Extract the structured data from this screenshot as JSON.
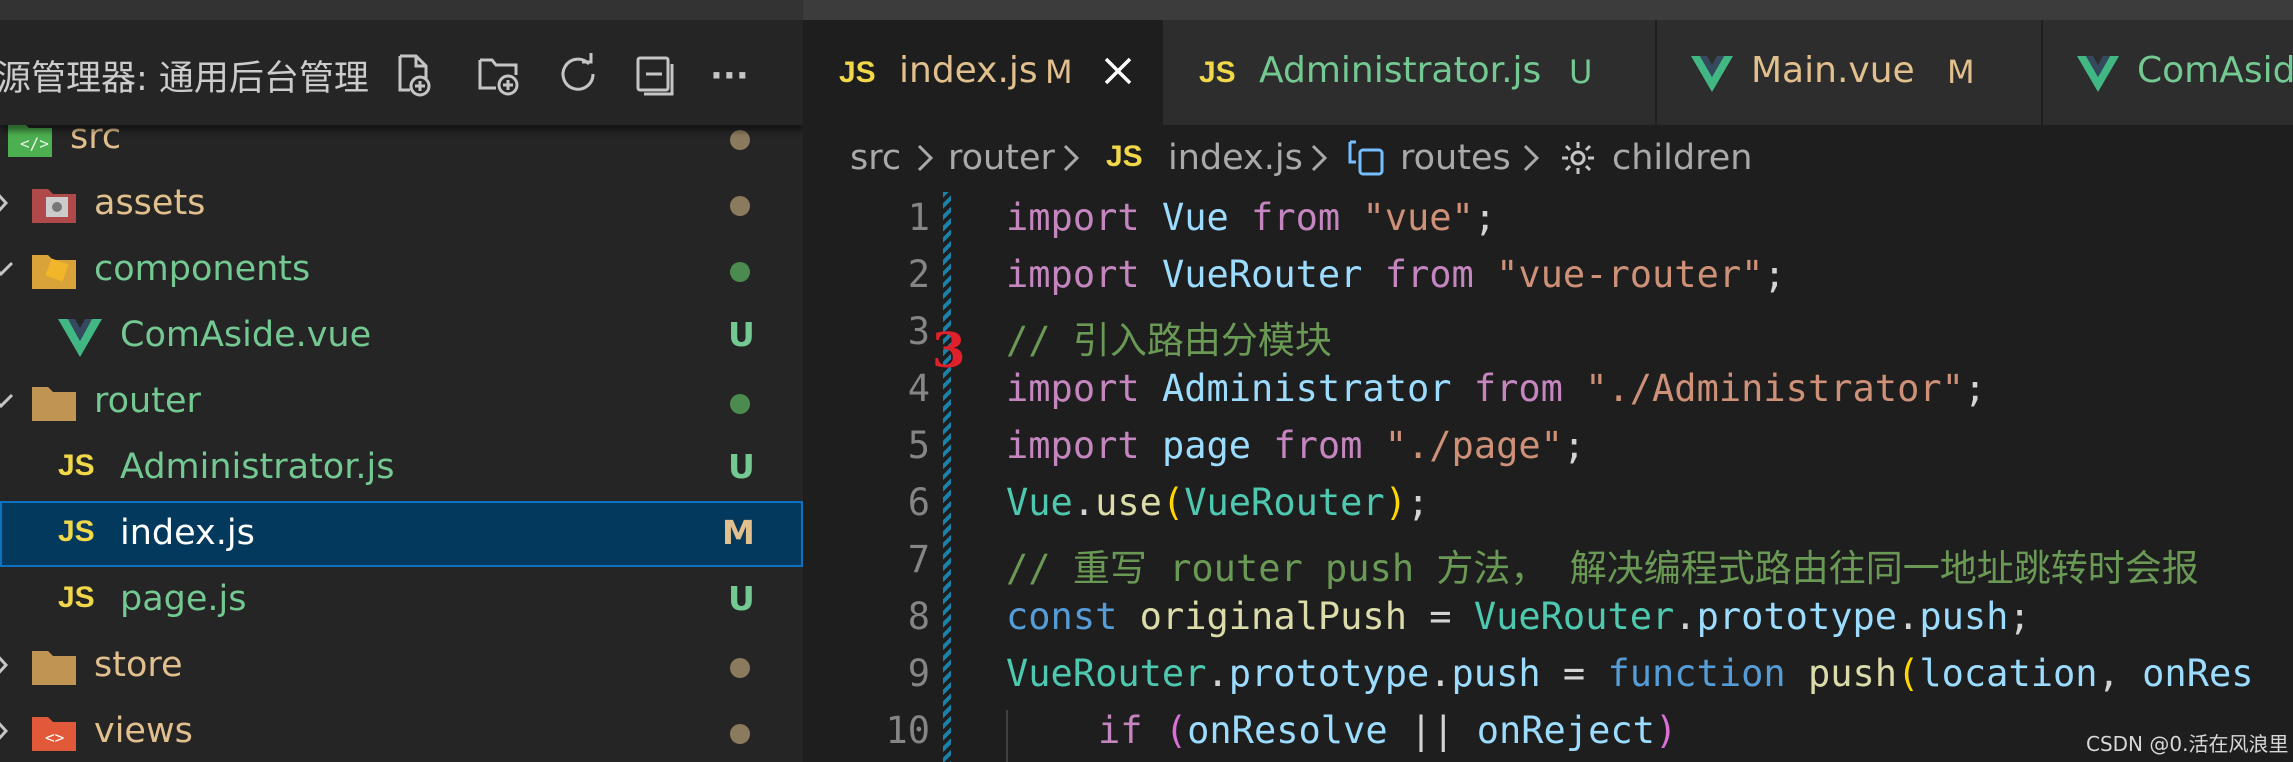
{
  "explorer": {
    "title": "源管理器: 通用后台管理",
    "actions": [
      "new-file",
      "new-folder",
      "refresh",
      "collapse-all",
      "more"
    ],
    "more_label": "···",
    "tree": [
      {
        "name": "src",
        "kind": "folder-src",
        "status": "",
        "dot": "#8a7a5e",
        "color": "#e2c08d"
      },
      {
        "name": "assets",
        "kind": "folder-assets",
        "status": "",
        "dot": "#8a7a5e",
        "color": "#e2c08d"
      },
      {
        "name": "components",
        "kind": "folder-components",
        "status": "",
        "dot": "#4b8b4f",
        "color": "#73c991"
      },
      {
        "name": "ComAside.vue",
        "kind": "vue",
        "status": "U",
        "color": "#73c991"
      },
      {
        "name": "router",
        "kind": "folder",
        "status": "",
        "dot": "#4b8b4f",
        "color": "#73c991"
      },
      {
        "name": "Administrator.js",
        "kind": "js",
        "status": "U",
        "color": "#73c991"
      },
      {
        "name": "index.js",
        "kind": "js",
        "status": "M",
        "color": "#ffffff",
        "selected": true
      },
      {
        "name": "page.js",
        "kind": "js",
        "status": "U",
        "color": "#73c991"
      },
      {
        "name": "store",
        "kind": "folder",
        "status": "",
        "dot": "#8a7a5e",
        "color": "#e2c08d"
      },
      {
        "name": "views",
        "kind": "folder-views",
        "status": "",
        "dot": "#8a7a5e",
        "color": "#e2c08d"
      }
    ]
  },
  "tabs": [
    {
      "label": "index.js",
      "badge": "JS",
      "status": "M",
      "active": true,
      "color": "#e2c08d"
    },
    {
      "label": "Administrator.js",
      "badge": "JS",
      "status": "U",
      "color": "#73c991"
    },
    {
      "label": "Main.vue",
      "badge": "V",
      "status": "M",
      "color": "#e2c08d"
    },
    {
      "label": "ComAside",
      "badge": "V",
      "status": "",
      "color": "#73c991"
    }
  ],
  "breadcrumb": {
    "src": "src",
    "router": "router",
    "js_badge": "JS",
    "file": "index.js",
    "routes": "routes",
    "children": "children"
  },
  "editor": {
    "line_numbers": [
      "1",
      "2",
      "3",
      "4",
      "5",
      "6",
      "7",
      "8",
      "9",
      "10"
    ],
    "marker": "3",
    "lines": {
      "l1": {
        "kw": "import",
        "id": "Vue",
        "from": "from",
        "str": "\"vue\"",
        "end": ";"
      },
      "l2": {
        "kw": "import",
        "id": "VueRouter",
        "from": "from",
        "str": "\"vue-router\"",
        "end": ";"
      },
      "l3": {
        "comment": "// 引入路由分模块"
      },
      "l4": {
        "kw": "import",
        "id": "Administrator",
        "from": "from",
        "str": "\"./Administrator\"",
        "end": ";"
      },
      "l5": {
        "kw": "import",
        "id": "page",
        "from": "from",
        "str": "\"./page\"",
        "end": ";"
      },
      "l6": {
        "obj": "Vue",
        "dot": ".",
        "method": "use",
        "open": "(",
        "arg": "VueRouter",
        "close": ")",
        "end": ";"
      },
      "l7": {
        "comment": "// 重写 router push 方法， 解决编程式路由往同一地址跳转时会报"
      },
      "l8": {
        "kw": "const",
        "id": "originalPush",
        "eq": " = ",
        "obj": "VueRouter",
        "d1": ".",
        "p1": "prototype",
        "d2": ".",
        "p2": "push",
        "end": ";"
      },
      "l9": {
        "obj": "VueRouter",
        "d1": ".",
        "p1": "prototype",
        "d2": ".",
        "p2": "push",
        "eq": " = ",
        "kw": "function",
        "fn": "push",
        "open": "(",
        "a1": "location",
        "comma": ", ",
        "a2": "onRes"
      },
      "l10": {
        "kw": "if",
        "open": "(",
        "a1": "onResolve",
        "op": " || ",
        "a2": "onReject",
        "close": ")"
      }
    }
  },
  "watermark": "CSDN @0.活在风浪里"
}
